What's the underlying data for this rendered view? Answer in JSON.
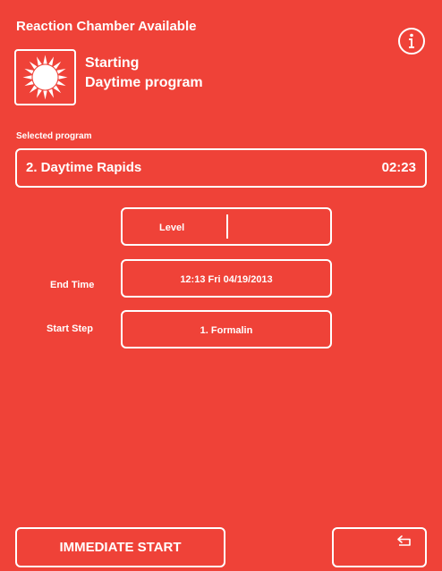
{
  "header": {
    "title": "Reaction Chamber Available",
    "info_icon": "info-icon"
  },
  "status": {
    "icon": "sun-icon",
    "line1": "Starting",
    "line2": "Daytime program"
  },
  "selected_program": {
    "label": "Selected program",
    "name": "2. Daytime Rapids",
    "duration": "02:23"
  },
  "fields": {
    "level_label": "Level",
    "level_value": "",
    "end_time_label": "End Time",
    "end_time_value": "12:13  Fri 04/19/2013",
    "start_step_label": "Start Step",
    "start_step_value": "1. Formalin"
  },
  "footer": {
    "immediate_start_label": "IMMEDIATE START",
    "back_icon": "return-arrow-icon"
  },
  "colors": {
    "background": "#ef4238",
    "foreground": "#ffffff"
  }
}
